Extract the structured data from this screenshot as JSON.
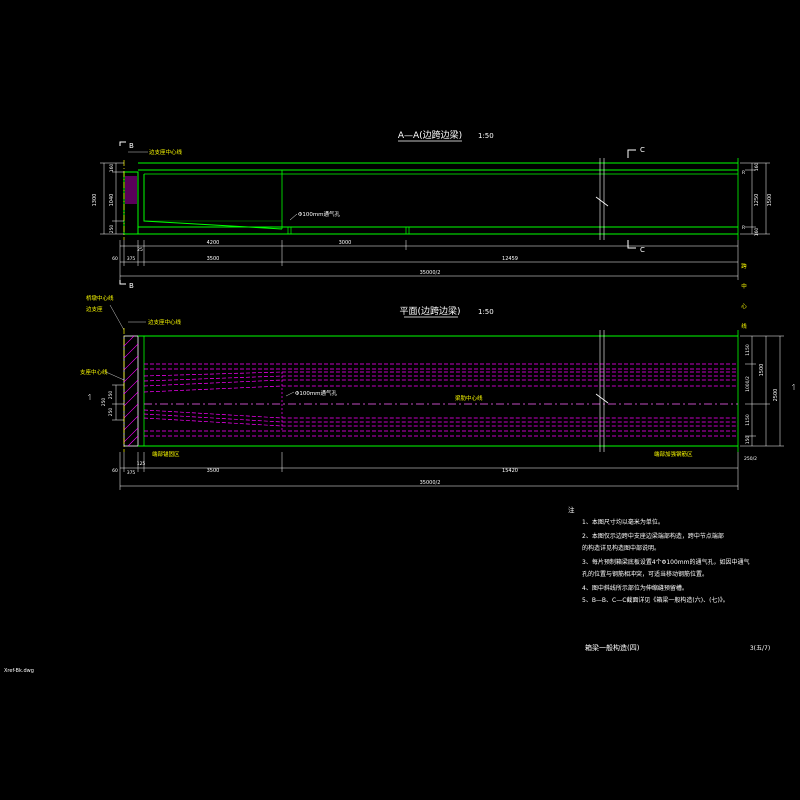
{
  "section": {
    "title": "A—A(边跨边梁)",
    "scale": "1:50",
    "cut_b": "B",
    "cut_c": "C",
    "label_support": "边支座中心线",
    "label_vent": "Φ100mm通气孔",
    "dims_left": [
      "160",
      "1300",
      "1040",
      "250",
      "250",
      "60"
    ],
    "dims_right": [
      "160",
      "1250",
      "1500",
      "160"
    ],
    "row1": [
      "60",
      "375",
      "3500",
      "12459"
    ],
    "row1_top": [
      "25",
      "4200",
      "3000"
    ],
    "row2": "35000/2"
  },
  "plan": {
    "title": "平面(边跨边梁)",
    "scale": "1:50",
    "cut_b": "B",
    "label_bridge_center": "桥墩中心线",
    "label_bearing_1": "边支座",
    "label_support": "边支座中心线",
    "label_left_a": "支座中心线",
    "label_vent": "Φ100mm通气孔",
    "label_beam_center": "梁肋中心线",
    "label_end_block": "端部锚固区",
    "label_right_note": "端部加强钢筋区",
    "dims_left": [
      "250",
      "250",
      "250"
    ],
    "dims_right": [
      "1150",
      "1000/2",
      "150",
      "1150",
      "1500",
      "2500"
    ],
    "row1": [
      "60",
      "375",
      "3500",
      "15420",
      "250/2"
    ],
    "row1_small": "125",
    "row2": "35000/2",
    "vertical_label": [
      "跨",
      "中",
      "心",
      "线"
    ]
  },
  "notes": {
    "heading": "注",
    "items": [
      "1、本图尺寸均以毫米为单位。",
      "2、本图仅示边跨中支座边梁端部构造，跨中节点端部",
      "   的构造详见构造图中部说明。",
      "3、每片预制箱梁底板设置4个Φ100mm的通气孔，如因中通气",
      "   孔的位置与钢筋相冲突，可适当移动钢筋位置。",
      "4、图中斜线所示部位为伸缩缝预留槽。",
      "5、B—B、C—C截面详见《箱梁一般构造(六)、(七)》。"
    ]
  },
  "titleblock": {
    "title": "箱梁一般构造(四)",
    "sheet": "3(五/7)"
  },
  "filename": "Xref-Bk.dwg",
  "colors": {
    "background": "#000000",
    "beam": "#00ff00",
    "dim": "#ffffff",
    "tendon": "#ff00ff",
    "hatch": "#ff00ff",
    "text_label": "#ffff00",
    "title": "#ffffff"
  }
}
